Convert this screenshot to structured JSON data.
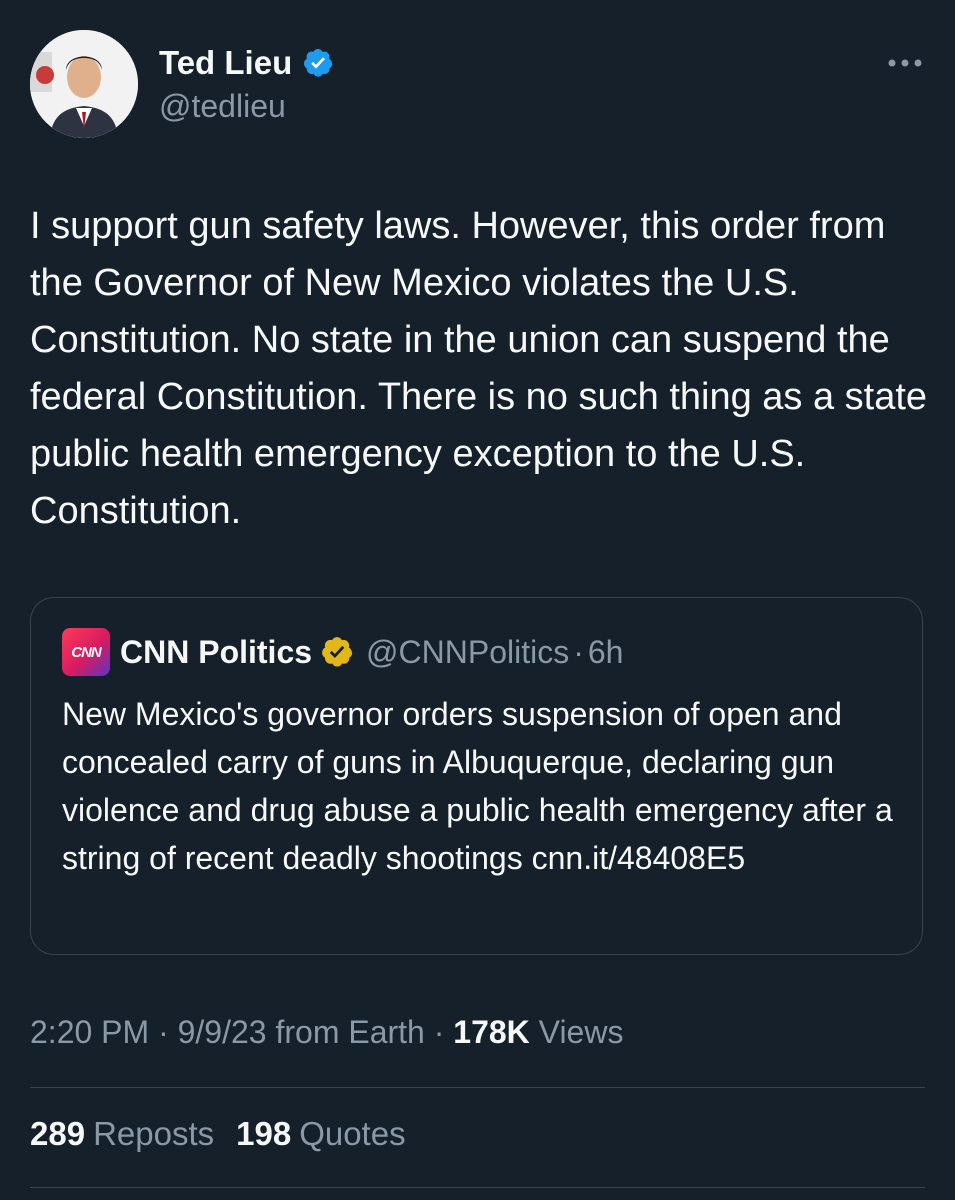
{
  "author": {
    "name": "Ted Lieu",
    "handle": "@tedlieu",
    "verified": true,
    "avatar_icon": "profile-photo"
  },
  "tweet": {
    "text": "I support gun safety laws. However, this order from the Governor of New Mexico violates the U.S. Constitution. No state in the union can suspend the federal Constitution. There is no such thing as a state public health emergency exception to the U.S. Constitution."
  },
  "quoted": {
    "logo_text": "CNN",
    "name": "CNN Politics",
    "handle": "@CNNPolitics",
    "separator": "·",
    "time": "6h",
    "text": "New Mexico's governor orders suspension of open and concealed carry of guns in Albuquerque, declaring gun violence and drug abuse a public health emergency after a string of recent deadly shootings cnn.it/48408E5"
  },
  "meta": {
    "time": "2:20 PM",
    "sep1": "·",
    "date": "9/9/23",
    "source": "from Earth",
    "sep2": "·",
    "views_count": "178K",
    "views_label": "Views"
  },
  "stats": {
    "reposts_count": "289",
    "reposts_label": "Reposts",
    "quotes_count": "198",
    "quotes_label": "Quotes"
  },
  "colors": {
    "background": "#15202b",
    "text": "#f7f9f9",
    "secondary": "#8b98a5",
    "border": "#38444d",
    "verified_blue": "#1d9bf0",
    "verified_gold": "#e2b719"
  }
}
